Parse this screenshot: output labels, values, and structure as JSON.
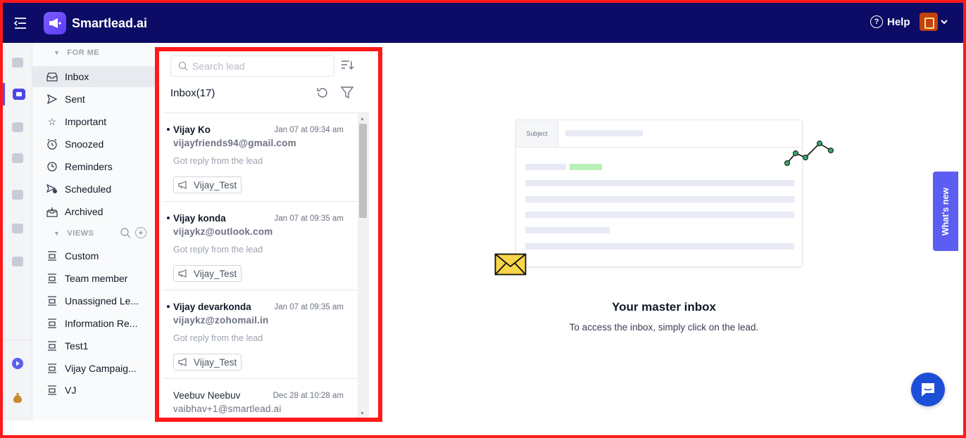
{
  "app": {
    "brand": "Smartlead.ai",
    "help_label": "Help"
  },
  "rail": {
    "icons": [
      "campaigns-icon",
      "master-inbox-icon",
      "email-accounts-icon",
      "lead-finder-icon",
      "integrations-icon",
      "automation-icon",
      "analytics-icon",
      "video-tutorials-icon",
      "billing-icon"
    ],
    "active": "master-inbox-icon"
  },
  "sidebar": {
    "for_me_label": "FOR ME",
    "items": [
      {
        "label": "Inbox",
        "icon": "inbox-icon"
      },
      {
        "label": "Sent",
        "icon": "send-icon"
      },
      {
        "label": "Important",
        "icon": "star-icon"
      },
      {
        "label": "Snoozed",
        "icon": "snooze-icon"
      },
      {
        "label": "Reminders",
        "icon": "clock-icon"
      },
      {
        "label": "Scheduled",
        "icon": "scheduled-icon"
      },
      {
        "label": "Archived",
        "icon": "archive-icon"
      }
    ],
    "views_label": "VIEWS",
    "views": [
      "Custom",
      "Team member",
      "Unassigned Le...",
      "Information Re...",
      "Test1",
      "Vijay Campaig...",
      "VJ"
    ]
  },
  "leads": {
    "search_placeholder": "Search lead",
    "title": "Inbox",
    "count": "(17)",
    "items": [
      {
        "name": "Vijay Ko",
        "date": "Jan 07 at 09:34 am",
        "email": "vijayfriends94@gmail.com",
        "status": "Got reply from the lead",
        "tag": "Vijay_Test",
        "unread": true
      },
      {
        "name": "Vijay konda",
        "date": "Jan 07 at 09:35 am",
        "email": "vijaykz@outlook.com",
        "status": "Got reply from the lead",
        "tag": "Vijay_Test",
        "unread": true
      },
      {
        "name": "Vijay devarkonda",
        "date": "Jan 07 at 09:35 am",
        "email": "vijaykz@zohomail.in",
        "status": "Got reply from the lead",
        "tag": "Vijay_Test",
        "unread": true
      },
      {
        "name": "Veebuv Neebuv",
        "date": "Dec 28 at 10:28 am",
        "email": "vaibhav+1@smartlead.ai",
        "status": "",
        "tag": "",
        "unread": false
      }
    ]
  },
  "empty_state": {
    "subject_label": "Subject",
    "title": "Your master inbox",
    "subtitle": "To access the inbox, simply click on the lead."
  },
  "whats_new_label": "What's new",
  "colors": {
    "topbar": "#0c0c66",
    "accent": "#5b5ef0",
    "highlight_outline": "#ff1a1a",
    "chat": "#1d4ed8"
  }
}
